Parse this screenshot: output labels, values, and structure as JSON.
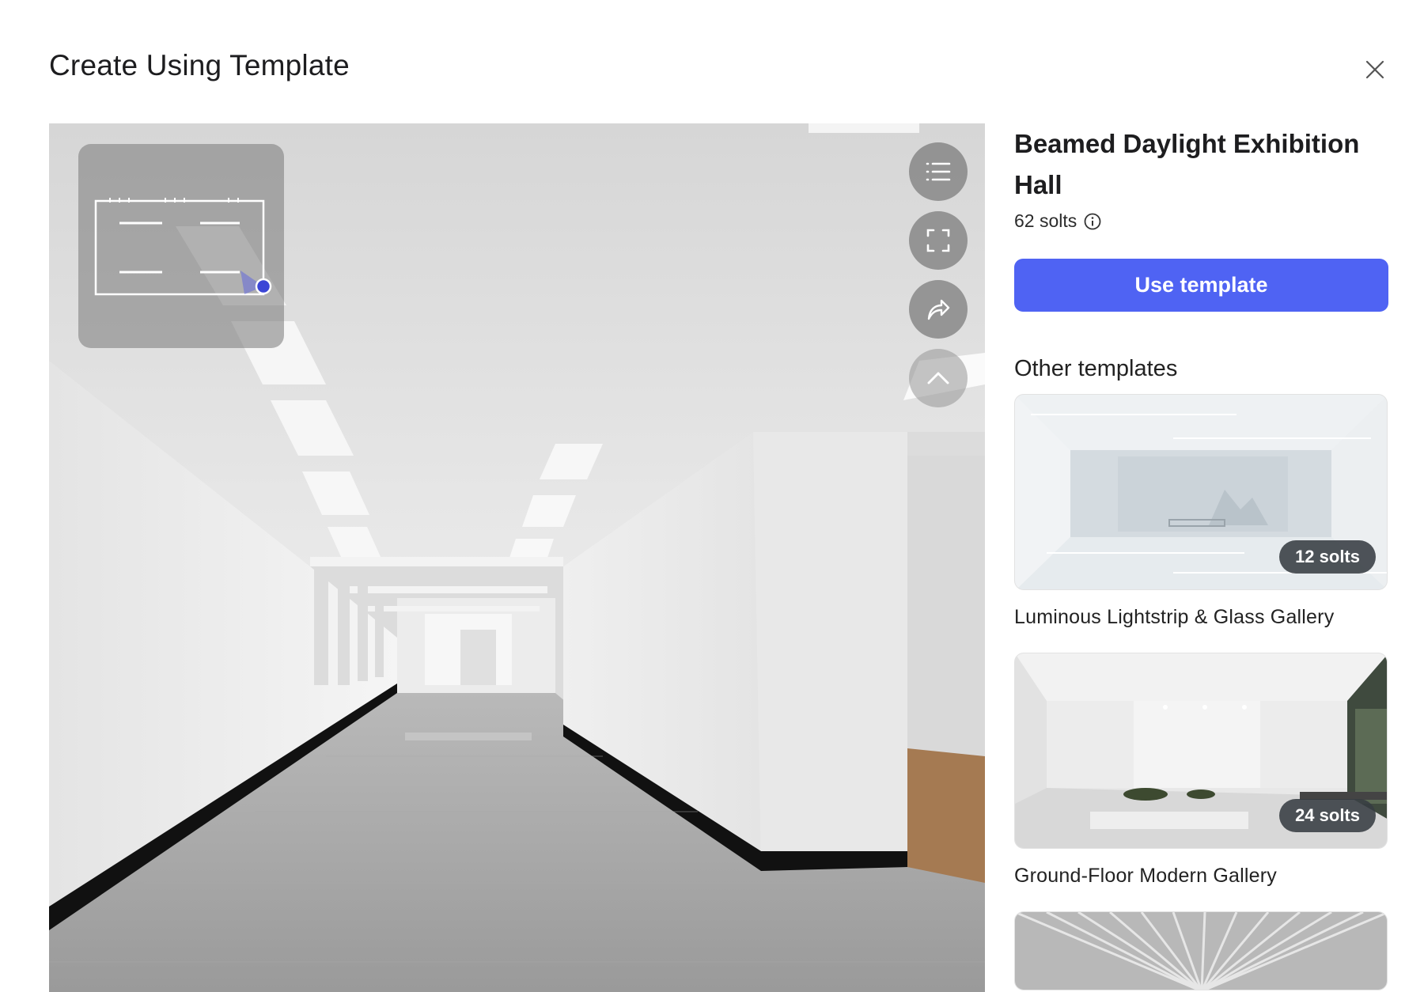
{
  "dialog": {
    "title": "Create Using Template",
    "close_icon": "close-icon"
  },
  "preview": {
    "toolbar": [
      {
        "name": "list-icon"
      },
      {
        "name": "fullscreen-icon"
      },
      {
        "name": "share-icon"
      },
      {
        "name": "chevron-up-icon"
      }
    ]
  },
  "template": {
    "name": "Beamed Daylight Exhibition Hall",
    "slots_text": "62 solts",
    "use_button_label": "Use template"
  },
  "other_templates": {
    "heading": "Other templates",
    "items": [
      {
        "name": "Luminous Lightstrip & Glass Gallery",
        "slots": "12 solts"
      },
      {
        "name": "Ground-Floor Modern Gallery",
        "slots": "24 solts"
      },
      {
        "name": "",
        "slots": ""
      }
    ]
  },
  "colors": {
    "accent": "#4f63f3",
    "badge": "#373c42",
    "minimap_marker": "#3b45d6"
  }
}
